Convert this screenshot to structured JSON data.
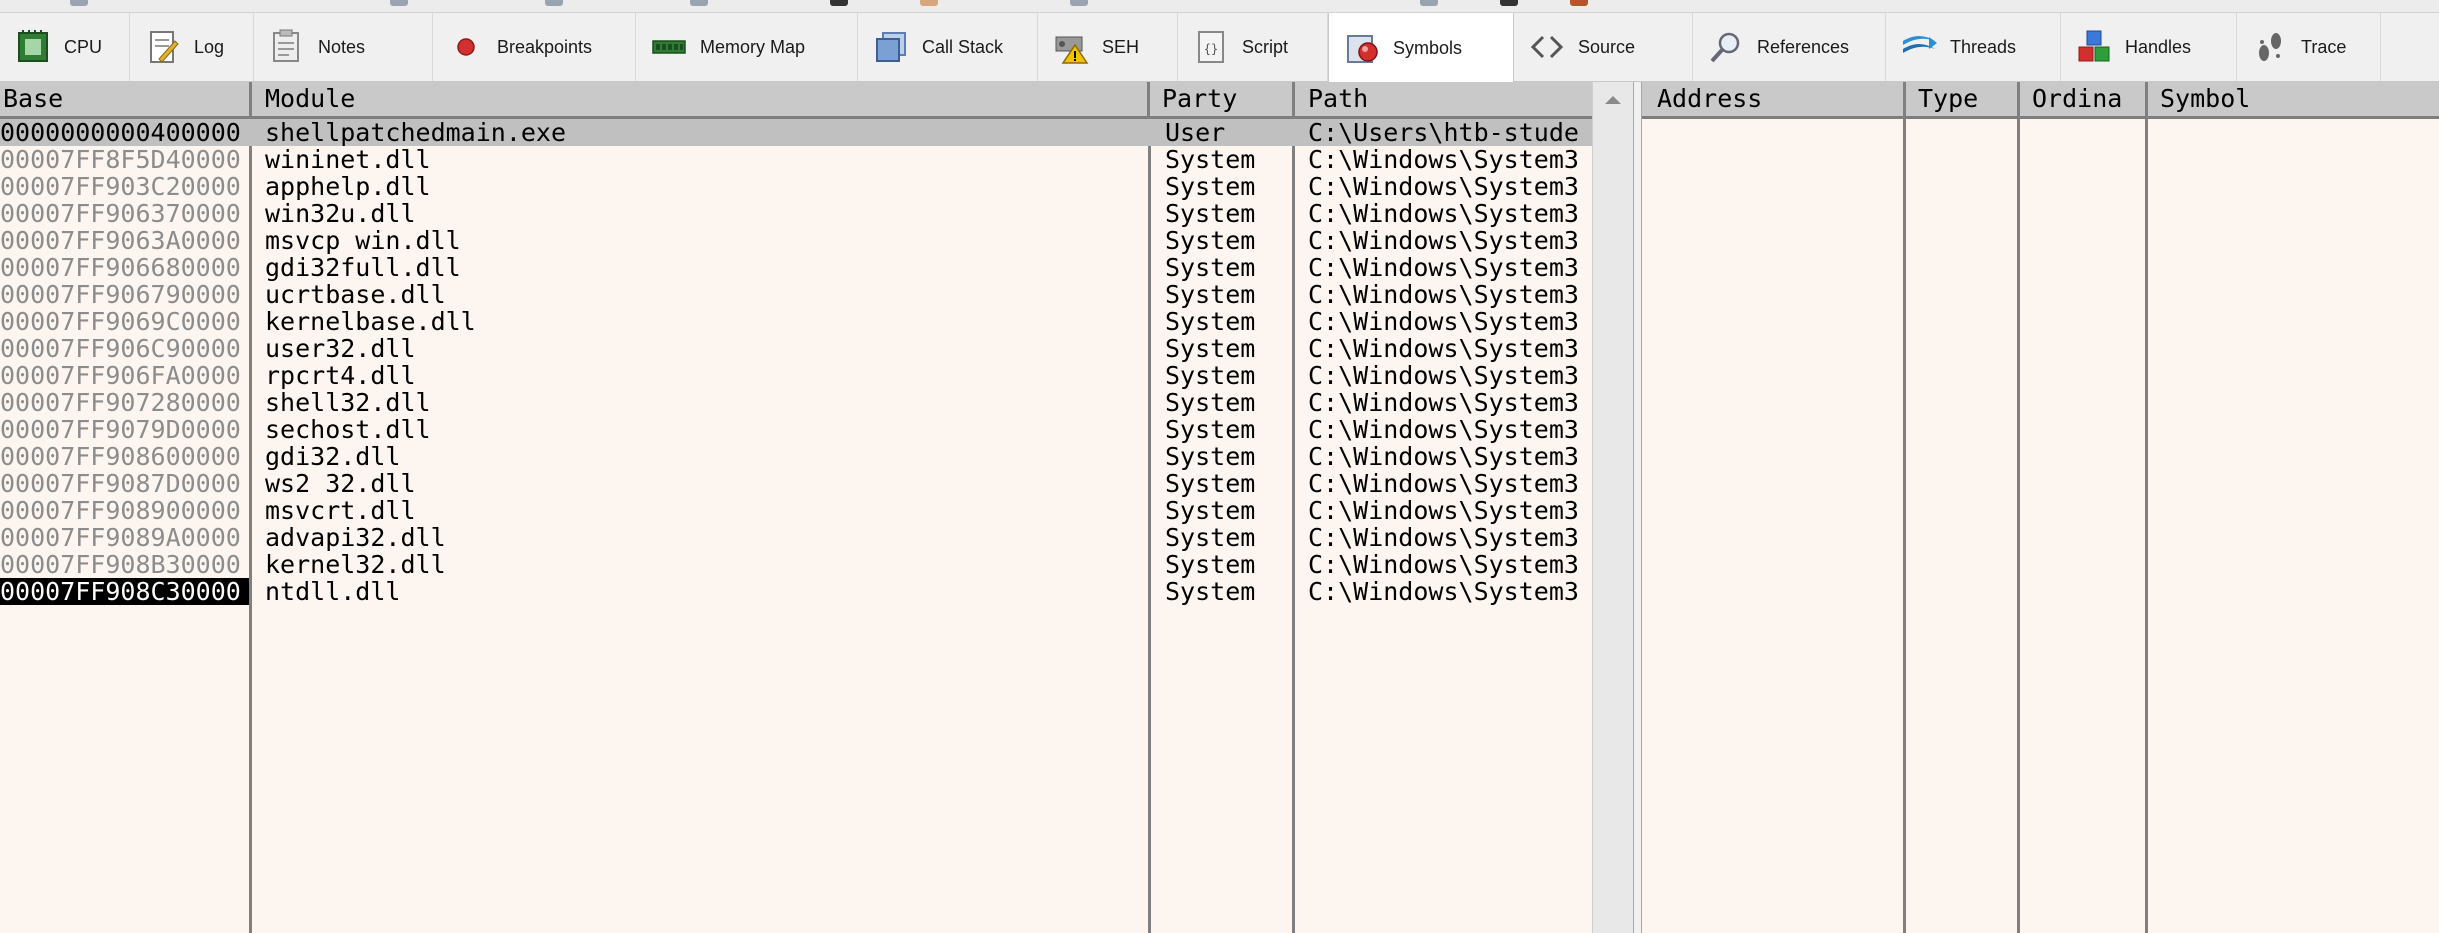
{
  "tabs": [
    {
      "name": "tab-cpu",
      "label": "CPU",
      "icon": "cpu-icon"
    },
    {
      "name": "tab-log",
      "label": "Log",
      "icon": "log-icon"
    },
    {
      "name": "tab-notes",
      "label": "Notes",
      "icon": "notes-icon"
    },
    {
      "name": "tab-breakpoints",
      "label": "Breakpoints",
      "icon": "breakpoint-icon"
    },
    {
      "name": "tab-memory-map",
      "label": "Memory Map",
      "icon": "memory-icon"
    },
    {
      "name": "tab-call-stack",
      "label": "Call Stack",
      "icon": "callstack-icon"
    },
    {
      "name": "tab-seh",
      "label": "SEH",
      "icon": "seh-icon"
    },
    {
      "name": "tab-script",
      "label": "Script",
      "icon": "script-icon"
    },
    {
      "name": "tab-symbols",
      "label": "Symbols",
      "icon": "symbols-icon",
      "active": true
    },
    {
      "name": "tab-source",
      "label": "Source",
      "icon": "source-icon"
    },
    {
      "name": "tab-references",
      "label": "References",
      "icon": "references-icon"
    },
    {
      "name": "tab-threads",
      "label": "Threads",
      "icon": "threads-icon"
    },
    {
      "name": "tab-handles",
      "label": "Handles",
      "icon": "handles-icon"
    },
    {
      "name": "tab-trace",
      "label": "Trace",
      "icon": "trace-icon"
    }
  ],
  "modules": {
    "headers": {
      "base": "Base",
      "module": "Module",
      "party": "Party",
      "path": "Path"
    },
    "rows": [
      {
        "base": "0000000000400000",
        "module": "shellpatchedmain.exe",
        "party": "User",
        "path": "C:\\Users\\htb-stude"
      },
      {
        "base": "00007FF8F5D40000",
        "module": "wininet.dll",
        "party": "System",
        "path": "C:\\Windows\\System3"
      },
      {
        "base": "00007FF903C20000",
        "module": "apphelp.dll",
        "party": "System",
        "path": "C:\\Windows\\System3"
      },
      {
        "base": "00007FF906370000",
        "module": "win32u.dll",
        "party": "System",
        "path": "C:\\Windows\\System3"
      },
      {
        "base": "00007FF9063A0000",
        "module": "msvcp_win.dll",
        "party": "System",
        "path": "C:\\Windows\\System3"
      },
      {
        "base": "00007FF906680000",
        "module": "gdi32full.dll",
        "party": "System",
        "path": "C:\\Windows\\System3"
      },
      {
        "base": "00007FF906790000",
        "module": "ucrtbase.dll",
        "party": "System",
        "path": "C:\\Windows\\System3"
      },
      {
        "base": "00007FF9069C0000",
        "module": "kernelbase.dll",
        "party": "System",
        "path": "C:\\Windows\\System3"
      },
      {
        "base": "00007FF906C90000",
        "module": "user32.dll",
        "party": "System",
        "path": "C:\\Windows\\System3"
      },
      {
        "base": "00007FF906FA0000",
        "module": "rpcrt4.dll",
        "party": "System",
        "path": "C:\\Windows\\System3"
      },
      {
        "base": "00007FF907280000",
        "module": "shell32.dll",
        "party": "System",
        "path": "C:\\Windows\\System3"
      },
      {
        "base": "00007FF9079D0000",
        "module": "sechost.dll",
        "party": "System",
        "path": "C:\\Windows\\System3"
      },
      {
        "base": "00007FF908600000",
        "module": "gdi32.dll",
        "party": "System",
        "path": "C:\\Windows\\System3"
      },
      {
        "base": "00007FF9087D0000",
        "module": "ws2_32.dll",
        "party": "System",
        "path": "C:\\Windows\\System3"
      },
      {
        "base": "00007FF908900000",
        "module": "msvcrt.dll",
        "party": "System",
        "path": "C:\\Windows\\System3"
      },
      {
        "base": "00007FF9089A0000",
        "module": "advapi32.dll",
        "party": "System",
        "path": "C:\\Windows\\System3"
      },
      {
        "base": "00007FF908B30000",
        "module": "kernel32.dll",
        "party": "System",
        "path": "C:\\Windows\\System3"
      },
      {
        "base": "00007FF908C30000",
        "module": "ntdll.dll",
        "party": "System",
        "path": "C:\\Windows\\System3"
      }
    ]
  },
  "symbols": {
    "headers": {
      "address": "Address",
      "type": "Type",
      "ordinal": "Ordina",
      "symbol": "Symbol"
    }
  }
}
